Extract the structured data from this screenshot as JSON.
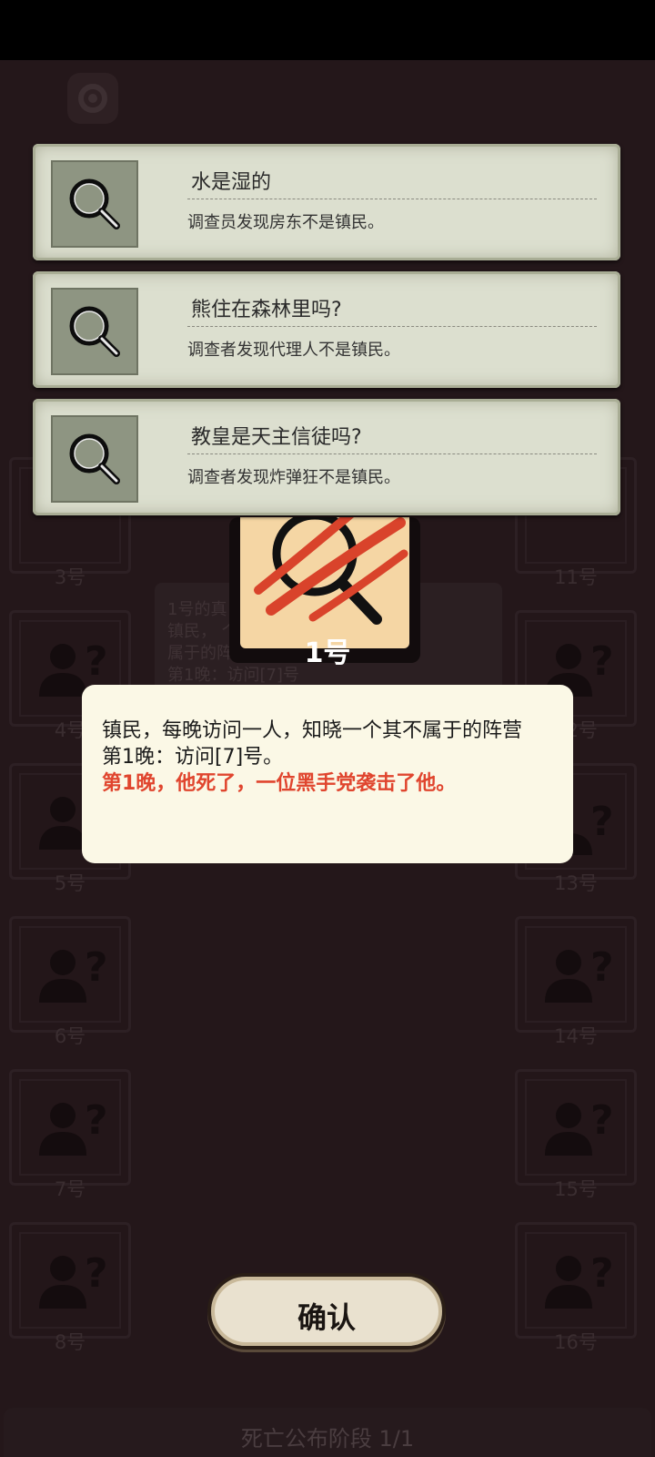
{
  "notifications": [
    {
      "title": "水是湿的",
      "subtitle": "调查员发现房东不是镇民。",
      "icon": "magnifier-icon"
    },
    {
      "title": "熊住在森林里吗?",
      "subtitle": "调查者发现代理人不是镇民。",
      "icon": "magnifier-icon"
    },
    {
      "title": "教皇是天主信徒吗?",
      "subtitle": "调查者发现炸弹狂不是镇民。",
      "icon": "magnifier-icon"
    }
  ],
  "players_left": [
    "3号",
    "4号",
    "5号",
    "6号",
    "7号",
    "8号"
  ],
  "players_right": [
    "11号",
    "12号",
    "13号",
    "14号",
    "15号",
    "16号"
  ],
  "role_card": {
    "number": "1号",
    "icon": "magnifier-with-claw-icon"
  },
  "log_panel": {
    "text": "1号的真\n镇民，          个其不\n属于的阵\n第1晚：访问[7]号"
  },
  "info_popup": {
    "line1": "镇民，每晚访问一人，知晓一个其不属于的阵营",
    "line2": "第1晚：访问[7]号。",
    "line3": "第1晚，他死了，一位黑手党袭击了他。"
  },
  "confirm_button": {
    "label": "确认"
  },
  "phase": {
    "text": "死亡公布阶段 1/1"
  },
  "colors": {
    "death_text": "#e0452e",
    "popup_bg": "#fbf8e6",
    "background": "#24171a"
  }
}
